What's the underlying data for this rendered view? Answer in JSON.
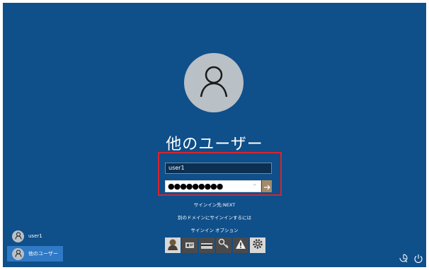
{
  "login": {
    "title": "他のユーザー",
    "username_value": "user1",
    "password_masked": "●●●●●●●●●",
    "password_hint": "ᵍᵇ",
    "submit_icon": "arrow-right-icon",
    "avatar_icon": "person-icon",
    "links": {
      "sign_in_to": "サインイン先:NEXT",
      "other_domain": "別のドメインにサインインするには",
      "sign_in_options": "サインイン オプション"
    },
    "options": [
      {
        "icon": "user-face-icon",
        "color": "#d8d8d8"
      },
      {
        "icon": "id-card-icon",
        "color": "#4a4a4a"
      },
      {
        "icon": "smart-card-icon",
        "color": "#4a4a4a"
      },
      {
        "icon": "key-icon",
        "color": "#4a4a4a"
      },
      {
        "icon": "warning-icon",
        "color": "#4a4a4a"
      },
      {
        "icon": "gear-icon",
        "color": "#d8d8d8"
      }
    ]
  },
  "users": [
    {
      "name": "user1",
      "selected": false
    },
    {
      "name": "他のユーザー",
      "selected": true
    }
  ],
  "corner": {
    "accessibility_icon": "accessibility-icon",
    "power_icon": "power-icon"
  },
  "colors": {
    "background": "#0f4f8a",
    "highlight": "#d9242b",
    "submit": "#a48a6a"
  }
}
